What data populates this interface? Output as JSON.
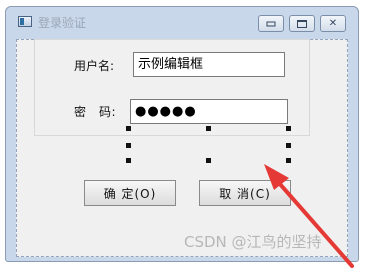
{
  "window": {
    "title": "登录验证"
  },
  "form": {
    "username_label": "用户名:",
    "username_value": "示例编辑框",
    "password_label": "密　码:",
    "password_value": "●●●●●"
  },
  "buttons": {
    "ok_label": "确 定(O)",
    "cancel_label": "取 消(C)"
  },
  "watermark": "CSDN @江鸟的坚持",
  "colors": {
    "arrow": "#e53935"
  }
}
